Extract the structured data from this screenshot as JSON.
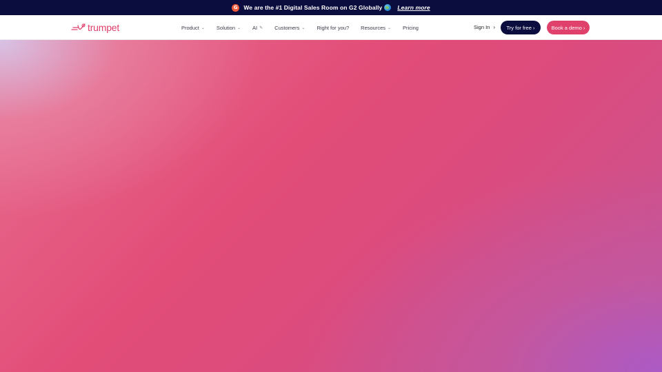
{
  "announcement": {
    "badge": "G",
    "text": "We are the #1 Digital Sales Room on G2 Globally",
    "link": "Learn more"
  },
  "nav": {
    "logo": "trumpet",
    "items": [
      {
        "label": "Product",
        "dropdown": true
      },
      {
        "label": "Solution",
        "dropdown": true
      },
      {
        "label": "AI",
        "dropdown": false,
        "suffix": "✎"
      },
      {
        "label": "Customers",
        "dropdown": true
      },
      {
        "label": "Right for you?",
        "dropdown": false
      },
      {
        "label": "Resources",
        "dropdown": true
      },
      {
        "label": "Pricing",
        "dropdown": false
      }
    ],
    "sign_in": "Sign In",
    "try_free": "Try for free",
    "book_demo": "Book a demo"
  },
  "colors": {
    "announcement_bg": "#0c0d3f",
    "brand": "#e0406c",
    "hero_start": "#e86d8f",
    "hero_end": "#a95cc4"
  }
}
